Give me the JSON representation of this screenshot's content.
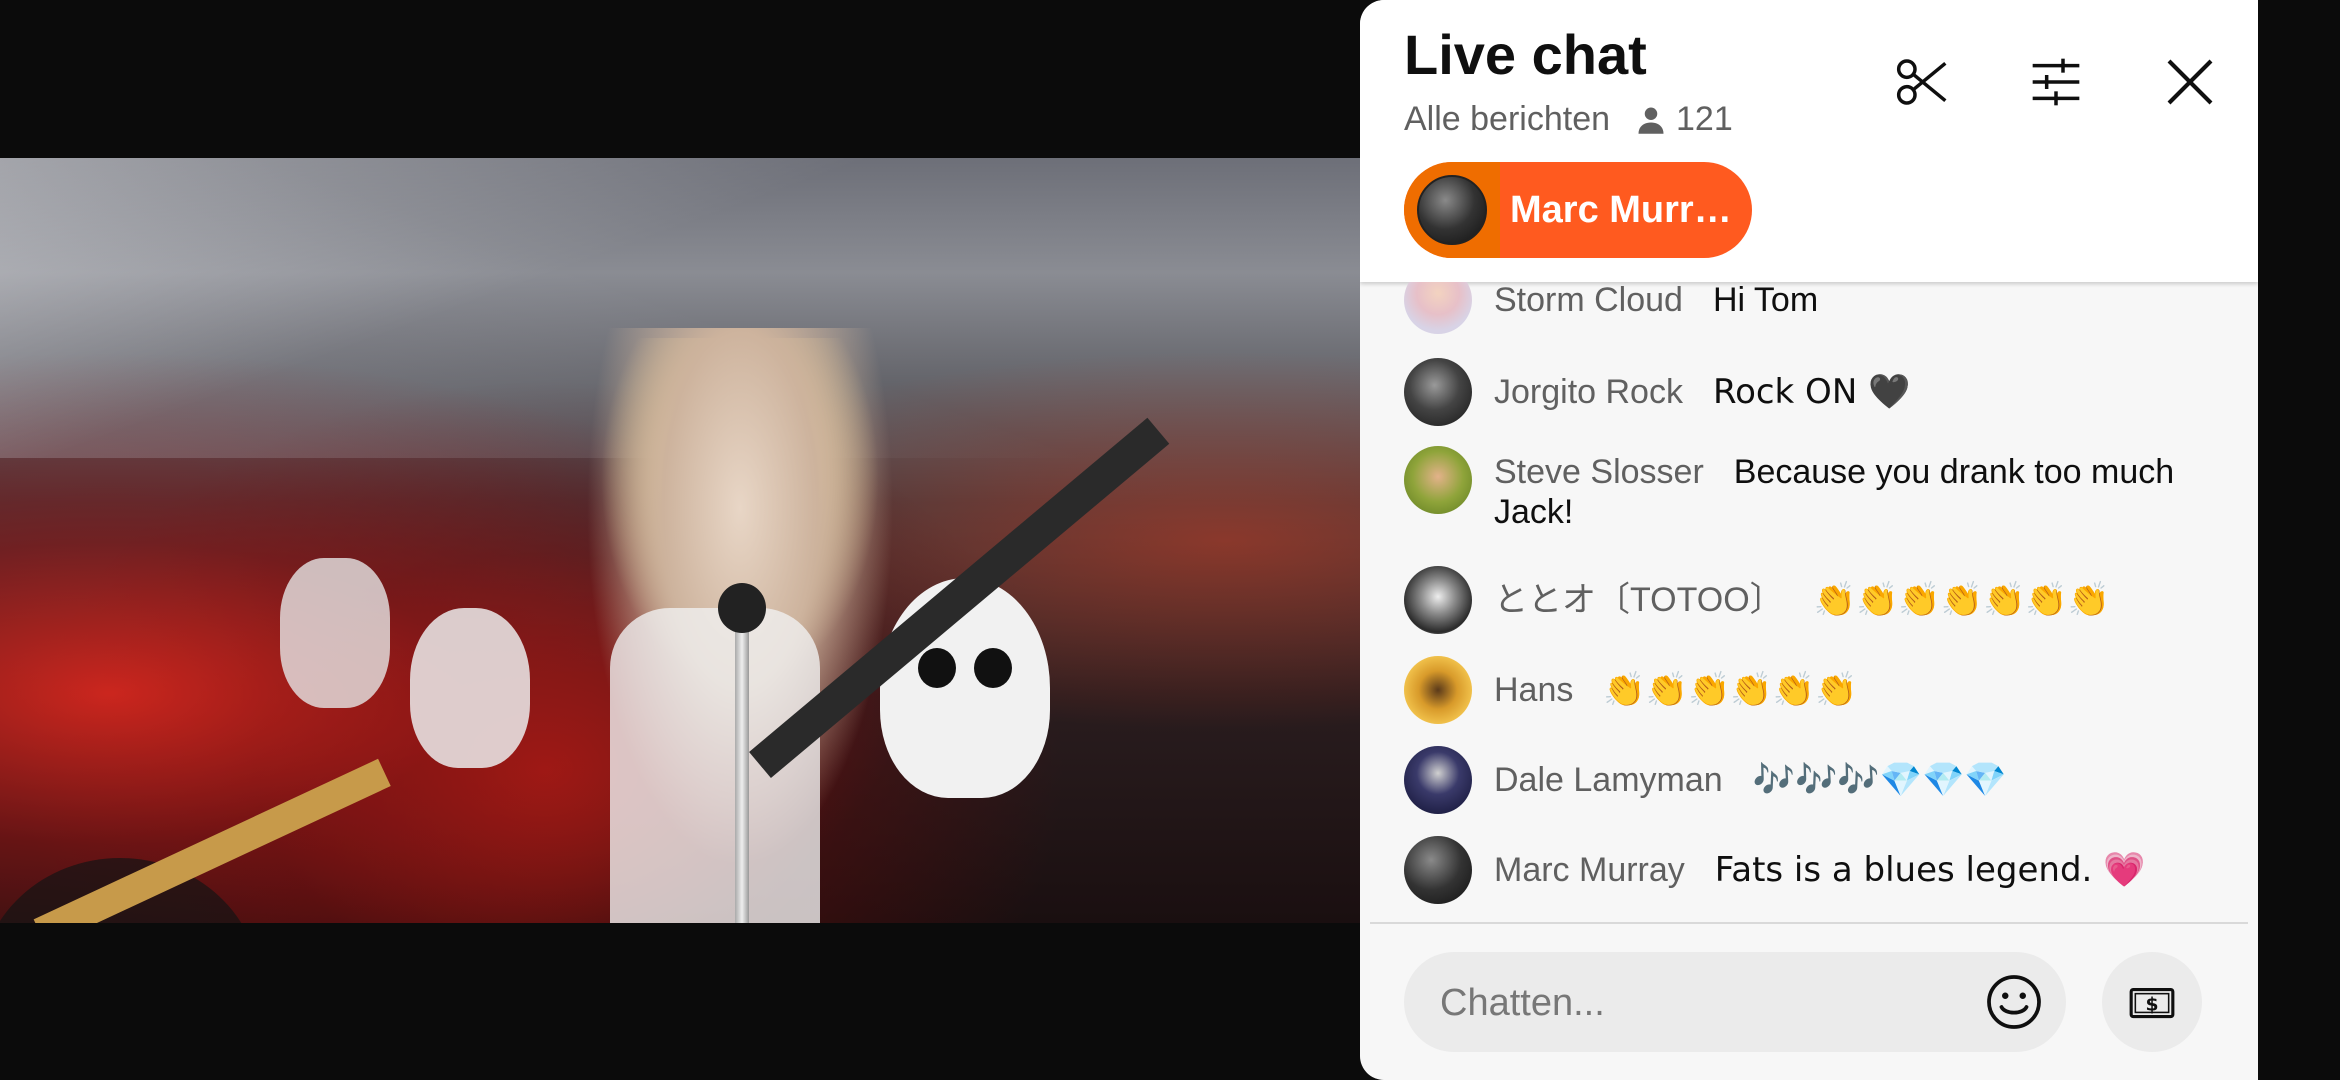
{
  "chat": {
    "title": "Live chat",
    "filter_label": "Alle berichten",
    "viewer_count": "121",
    "pinned_author": "Marc Murr…",
    "input_placeholder": "Chatten...",
    "messages": [
      {
        "author": "Storm Cloud",
        "text": "Hi Tom"
      },
      {
        "author": "Jorgito Rock",
        "text": "Rock ON 🖤"
      },
      {
        "author": "Steve Slosser",
        "text": "Because you drank too much Jack!"
      },
      {
        "author": "ととオ〔TOTOO〕",
        "text": "👏👏👏👏👏👏👏"
      },
      {
        "author": "Hans",
        "text": "👏👏👏👏👏👏"
      },
      {
        "author": "Dale Lamyman",
        "text": "🎶🎶🎶💎💎💎"
      },
      {
        "author": "Marc Murray",
        "text": "Fats is a blues legend. 💗"
      }
    ]
  },
  "icons": {
    "clip": "scissors-icon",
    "settings": "sliders-icon",
    "close": "close-icon",
    "viewers": "person-icon",
    "emoji": "smiley-icon",
    "super_chat": "dollar-bill-icon"
  },
  "colors": {
    "pinned_bg": "#ff5a1f",
    "panel_bg": "#f7f7f7",
    "author": "#606060"
  }
}
